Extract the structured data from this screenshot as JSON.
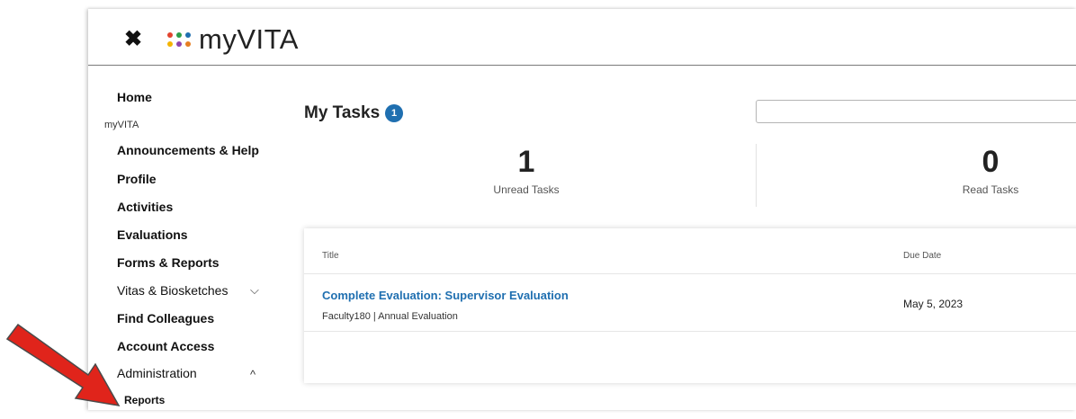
{
  "app": {
    "close_icon": "close-icon",
    "logo_text": "myVITA",
    "logo_dot_colors": [
      "#e2442f",
      "#2e9e4a",
      "#1f6fb0",
      "#f4b400",
      "#8e44ad",
      "#e67e22"
    ]
  },
  "sidebar": {
    "home": "Home",
    "section": "myVITA",
    "items": [
      {
        "label": "Announcements & Help"
      },
      {
        "label": "Profile"
      },
      {
        "label": "Activities"
      },
      {
        "label": "Evaluations"
      },
      {
        "label": "Forms & Reports"
      },
      {
        "label": "Vitas & Biosketches"
      },
      {
        "label": "Find Colleagues"
      },
      {
        "label": "Account Access"
      },
      {
        "label": "Administration"
      }
    ],
    "sub_items": [
      {
        "label": "Reports"
      }
    ]
  },
  "main": {
    "title": "My Tasks",
    "badge_count": "1",
    "search": {
      "value": "",
      "placeholder": ""
    },
    "stats": [
      {
        "value": "1",
        "label": "Unread Tasks"
      },
      {
        "value": "0",
        "label": "Read Tasks"
      }
    ],
    "table": {
      "headers": [
        "Title",
        "Due Date"
      ],
      "rows": [
        {
          "title": "Complete Evaluation: Supervisor Evaluation",
          "subtitle": "Faculty180 | Annual Evaluation",
          "due": "May 5, 2023"
        }
      ]
    }
  },
  "annotation": {
    "arrow_color": "#e0241b"
  }
}
